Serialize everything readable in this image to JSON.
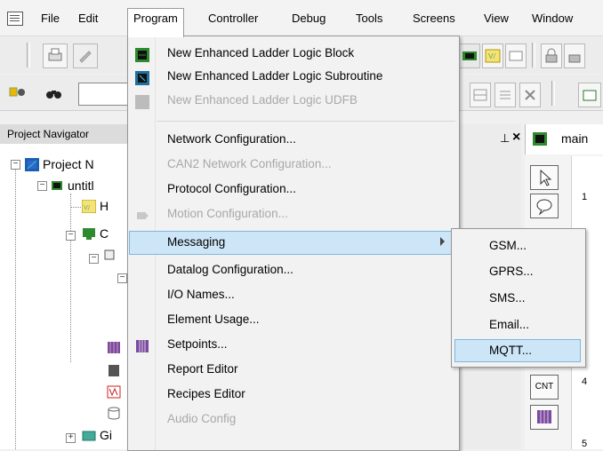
{
  "menubar": {
    "items": [
      "File",
      "Edit",
      "Program",
      "Controller",
      "Debug",
      "Tools",
      "Screens",
      "View",
      "Window"
    ],
    "active": "Program"
  },
  "navigator": {
    "title": "Project Navigator",
    "tree": [
      "Project N",
      "untitl",
      "H",
      "C",
      "Gi"
    ]
  },
  "document": {
    "tab_title": "main",
    "rungs": [
      "1",
      "4",
      "5"
    ],
    "pin_glyph": "⊥",
    "close_glyph": "×",
    "counter_label": "CNT"
  },
  "program_menu": {
    "items": [
      {
        "label": "New Enhanced Ladder Logic Block",
        "enabled": true,
        "icon": "ladder-block-icon"
      },
      {
        "label": "New Enhanced Ladder Logic Subroutine",
        "enabled": true,
        "icon": "ladder-subroutine-icon"
      },
      {
        "label": "New Enhanced Ladder Logic UDFB",
        "enabled": false,
        "icon": "udfb-icon"
      },
      {
        "label": "Network Configuration...",
        "enabled": true
      },
      {
        "label": "CAN2 Network Configuration...",
        "enabled": false
      },
      {
        "label": "Protocol Configuration...",
        "enabled": true
      },
      {
        "label": "Motion Configuration...",
        "enabled": false,
        "icon": "motion-icon"
      },
      {
        "label": "Messaging",
        "enabled": true,
        "submenu": true
      },
      {
        "label": "Datalog Configuration...",
        "enabled": true
      },
      {
        "label": "I/O Names...",
        "enabled": true
      },
      {
        "label": "Element Usage...",
        "enabled": true
      },
      {
        "label": "Setpoints...",
        "enabled": true,
        "icon": "setpoints-icon"
      },
      {
        "label": "Report Editor",
        "enabled": true
      },
      {
        "label": "Recipes Editor",
        "enabled": true
      },
      {
        "label": "Audio Config",
        "enabled": false
      }
    ]
  },
  "messaging_submenu": {
    "items": [
      "GSM...",
      "GPRS...",
      "SMS...",
      "Email...",
      "MQTT..."
    ],
    "highlighted": "MQTT..."
  },
  "colors": {
    "highlight_fill": "#cde6f7",
    "highlight_border": "#7fb6dc",
    "disabled_text": "#a8a8a8"
  }
}
